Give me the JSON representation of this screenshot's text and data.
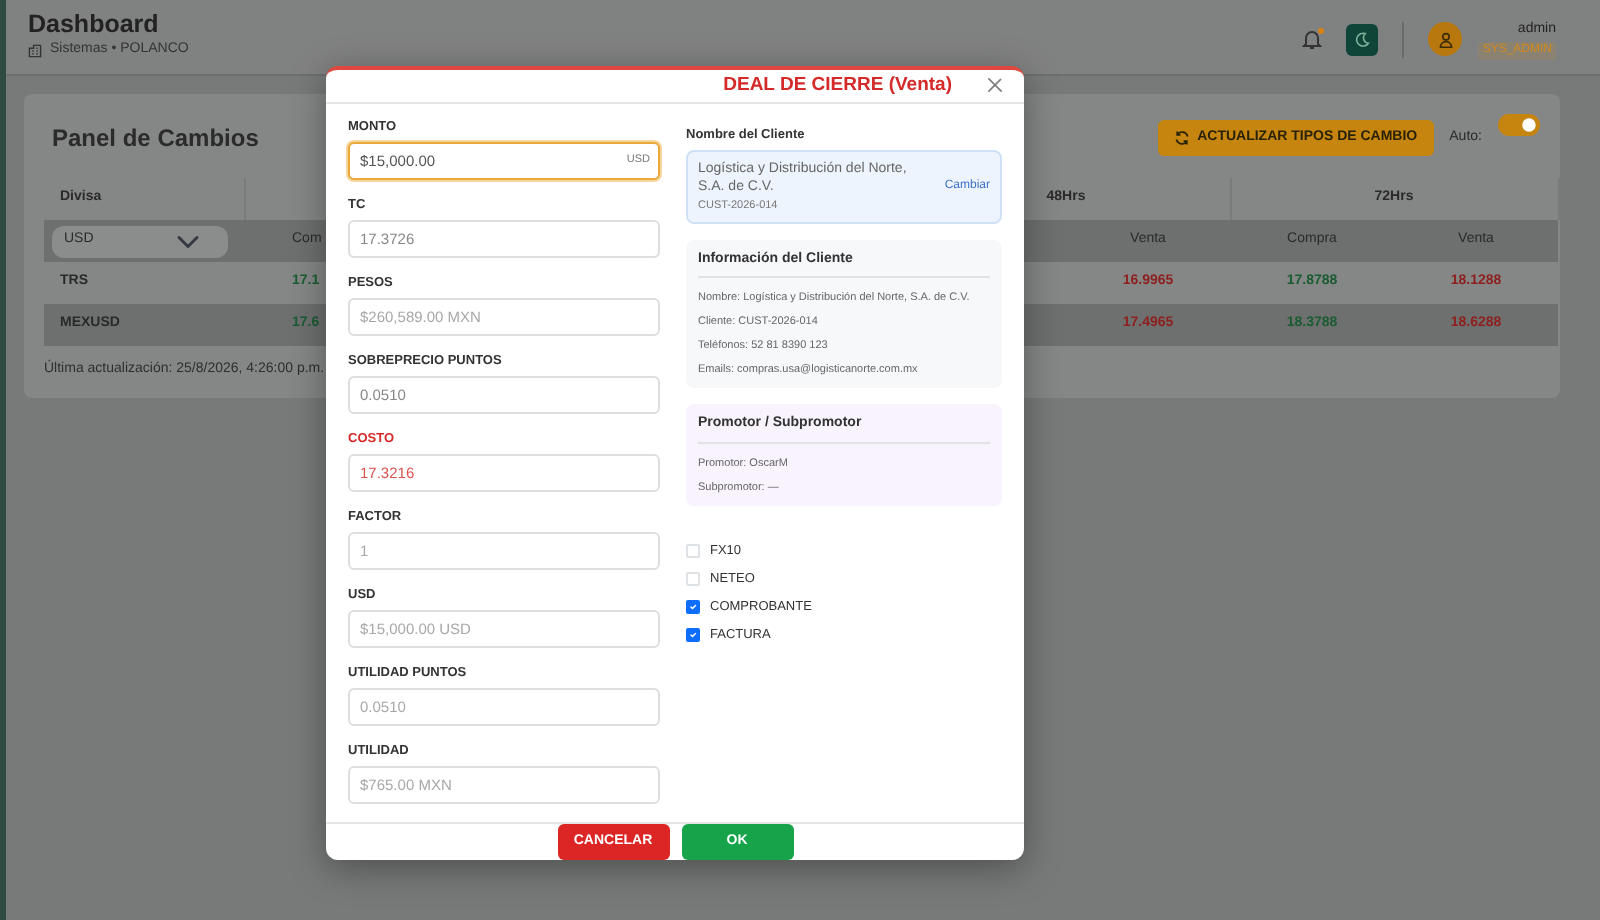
{
  "header": {
    "title": "Dashboard",
    "subtitle": "Sistemas • POLANCO",
    "notification_dot": true,
    "user": {
      "name": "admin",
      "role": "SYS_ADMIN"
    }
  },
  "panel": {
    "title": "Panel de Cambios",
    "refresh_button": "ACTUALIZAR TIPOS DE CAMBIO",
    "auto_label": "Auto:",
    "auto_on": true,
    "table": {
      "headers": [
        "Divisa",
        "48Hrs",
        "72Hrs"
      ],
      "currency_select": "USD",
      "subheaders": [
        "Com",
        "Venta",
        "Compra",
        "Venta"
      ],
      "rows": [
        {
          "name": "TRS",
          "cells": [
            {
              "text": "17.1",
              "kind": "buy"
            },
            {
              "text": "16.9965",
              "kind": "sell"
            },
            {
              "text": "17.8788",
              "kind": "buy"
            },
            {
              "text": "18.1288",
              "kind": "sell"
            }
          ]
        },
        {
          "name": "MEXUSD",
          "cells": [
            {
              "text": "17.6",
              "kind": "buy"
            },
            {
              "text": "17.4965",
              "kind": "sell"
            },
            {
              "text": "18.3788",
              "kind": "buy"
            },
            {
              "text": "18.6288",
              "kind": "sell"
            }
          ]
        }
      ]
    },
    "last_update": "Última actualización: 25/8/2026, 4:26:00 p.m."
  },
  "modal": {
    "title": "DEAL DE CIERRE (Venta)",
    "fields": [
      {
        "label": "MONTO",
        "value": "$15,000.00",
        "suffix": "USD",
        "kind": "input",
        "focused": true
      },
      {
        "label": "TC",
        "value": "17.3726",
        "kind": "input",
        "focused": false
      },
      {
        "label": "PESOS",
        "value": "$260,589.00 MXN",
        "kind": "computed",
        "focused": false
      },
      {
        "label": "SOBREPRECIO PUNTOS",
        "value": "0.0510",
        "kind": "input",
        "focused": false
      },
      {
        "label": "COSTO",
        "value": "17.3216",
        "kind": "cost",
        "focused": false
      },
      {
        "label": "FACTOR",
        "value": "1",
        "kind": "computed",
        "focused": false
      },
      {
        "label": "USD",
        "value": "$15,000.00 USD",
        "kind": "computed",
        "focused": false
      },
      {
        "label": "UTILIDAD PUNTOS",
        "value": "0.0510",
        "kind": "computed",
        "focused": false
      },
      {
        "label": "UTILIDAD",
        "value": "$765.00 MXN",
        "kind": "computed",
        "focused": false
      }
    ],
    "client": {
      "label": "Nombre del Cliente",
      "name": "Logística y Distribución del Norte, S.A. de C.V.",
      "code": "CUST-2026-014",
      "change_link": "Cambiar"
    },
    "client_info": {
      "title": "Información del Cliente",
      "lines": [
        "Nombre: Logística y Distribución del Norte, S.A. de C.V.",
        "Cliente: CUST-2026-014",
        "Teléfonos: 52 81 8390 123",
        "Emails: compras.usa@logisticanorte.com.mx"
      ]
    },
    "promoter": {
      "title": "Promotor / Subpromotor",
      "lines": [
        "Promotor: OscarM",
        "Subpromotor: —"
      ]
    },
    "options": [
      {
        "label": "FX10",
        "checked": false
      },
      {
        "label": "NETEO",
        "checked": false
      },
      {
        "label": "COMPROBANTE",
        "checked": true
      },
      {
        "label": "FACTURA",
        "checked": true
      }
    ],
    "buttons": [
      {
        "label": "CANCELAR",
        "kind": "cancel"
      },
      {
        "label": "OK",
        "kind": "confirm"
      }
    ]
  }
}
